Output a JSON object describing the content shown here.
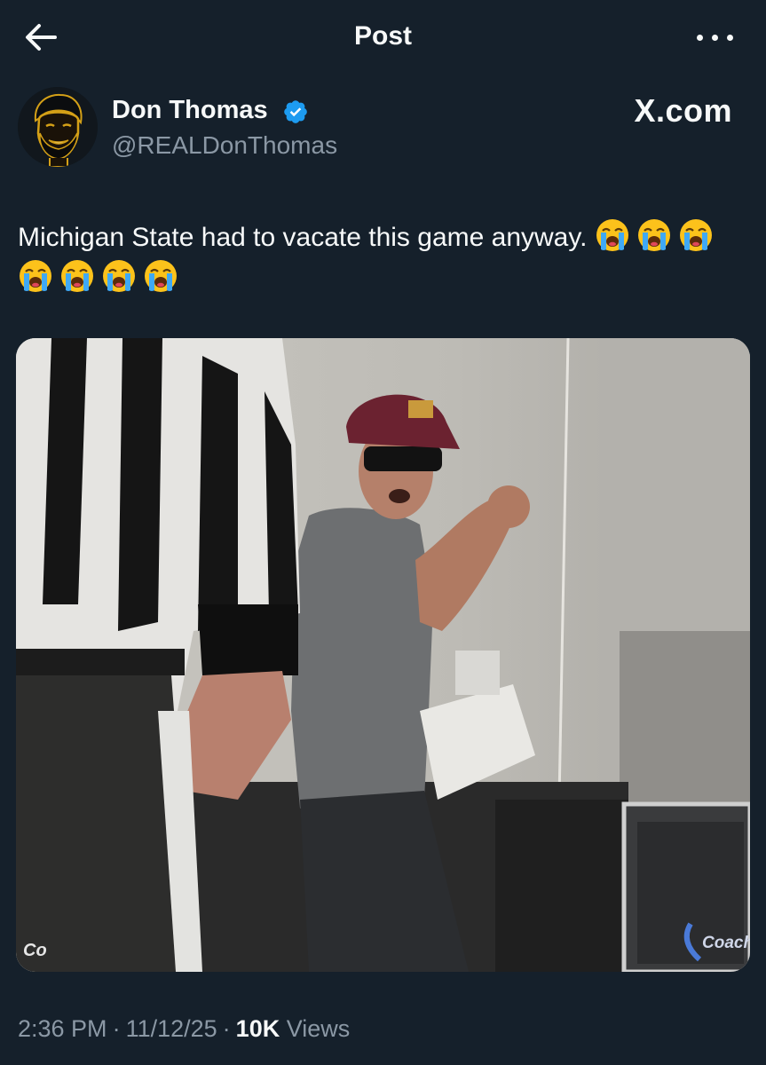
{
  "header": {
    "title": "Post",
    "back_icon": "arrow-left-icon",
    "more_icon": "more-horizontal-icon"
  },
  "author": {
    "name": "Don Thomas",
    "handle": "@REALDonThomas",
    "verified": true,
    "verified_color": "#1d9bf0",
    "avatar_icon": "avatar-illustration"
  },
  "source_label": "X.com",
  "tweet": {
    "text": "Michigan State had to vacate this game anyway.",
    "emoji_count": 7,
    "emoji_name": "loudly-crying-face"
  },
  "photo": {
    "watermark_left": "Co",
    "watermark_right": "Coach"
  },
  "meta": {
    "time": "2:36 PM",
    "date": "11/12/25",
    "views_count": "10K",
    "views_label": "Views"
  },
  "colors": {
    "background": "#15202b",
    "text_primary": "#f7f9f9",
    "text_secondary": "#8b98a5",
    "accent": "#1d9bf0"
  }
}
